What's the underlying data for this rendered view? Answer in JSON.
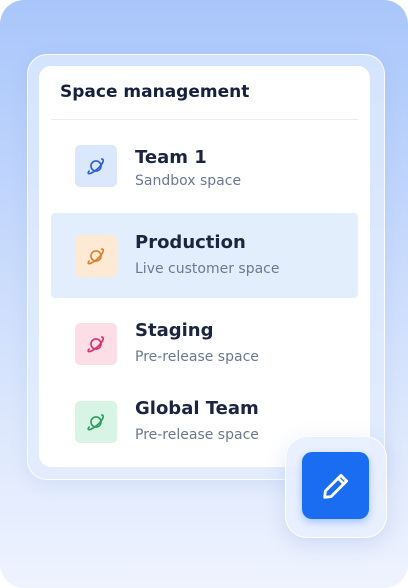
{
  "panel": {
    "title": "Space management"
  },
  "spaces": [
    {
      "name": "Team 1",
      "description": "Sandbox space",
      "icon": "planet-icon",
      "icon_color": "#2c5fd6",
      "icon_bg": "#dbe7fd",
      "selected": false
    },
    {
      "name": "Production",
      "description": "Live customer space",
      "icon": "planet-icon",
      "icon_color": "#d9822b",
      "icon_bg": "#fde9d4",
      "selected": true
    },
    {
      "name": "Staging",
      "description": "Pre-release space",
      "icon": "planet-icon",
      "icon_color": "#d6336c",
      "icon_bg": "#fddde6",
      "selected": false
    },
    {
      "name": "Global Team",
      "description": "Pre-release space",
      "icon": "planet-icon",
      "icon_color": "#2f9e5f",
      "icon_bg": "#d8f4e4",
      "selected": false
    }
  ],
  "fab": {
    "icon": "pencil-icon",
    "color": "#1a6cf0"
  },
  "colors": {
    "selected_row": "#e3eefc",
    "title_text": "#14213d"
  }
}
